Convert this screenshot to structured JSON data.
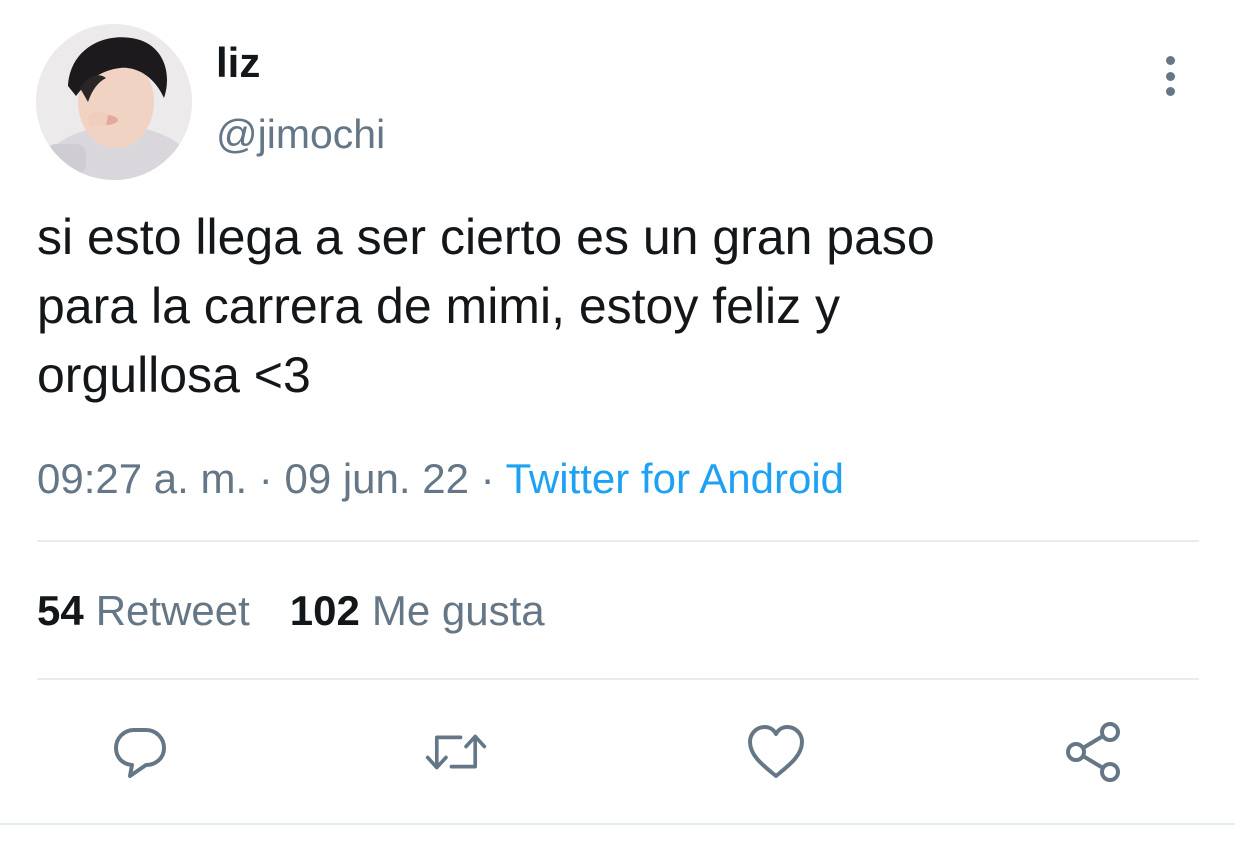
{
  "user": {
    "display_name": "liz",
    "handle": "@jimochi",
    "avatar_icon": "profile-photo"
  },
  "tweet": {
    "text": "si esto llega a ser cierto es un gran paso\npara la carrera de mimi, estoy feliz y\norgullosa <3",
    "time": "09:27 a. m.",
    "separator": "·",
    "date": "09 jun. 22",
    "source": "Twitter for Android"
  },
  "stats": {
    "retweets_count": "54",
    "retweets_label": "Retweet",
    "likes_count": "102",
    "likes_label": "Me gusta"
  },
  "actions": {
    "reply_icon": "reply-icon",
    "retweet_icon": "retweet-icon",
    "like_icon": "heart-icon",
    "share_icon": "share-icon"
  },
  "colors": {
    "text": "#14171a",
    "secondary": "#657786",
    "link": "#1da1f2",
    "divider": "#e6ecf0"
  }
}
